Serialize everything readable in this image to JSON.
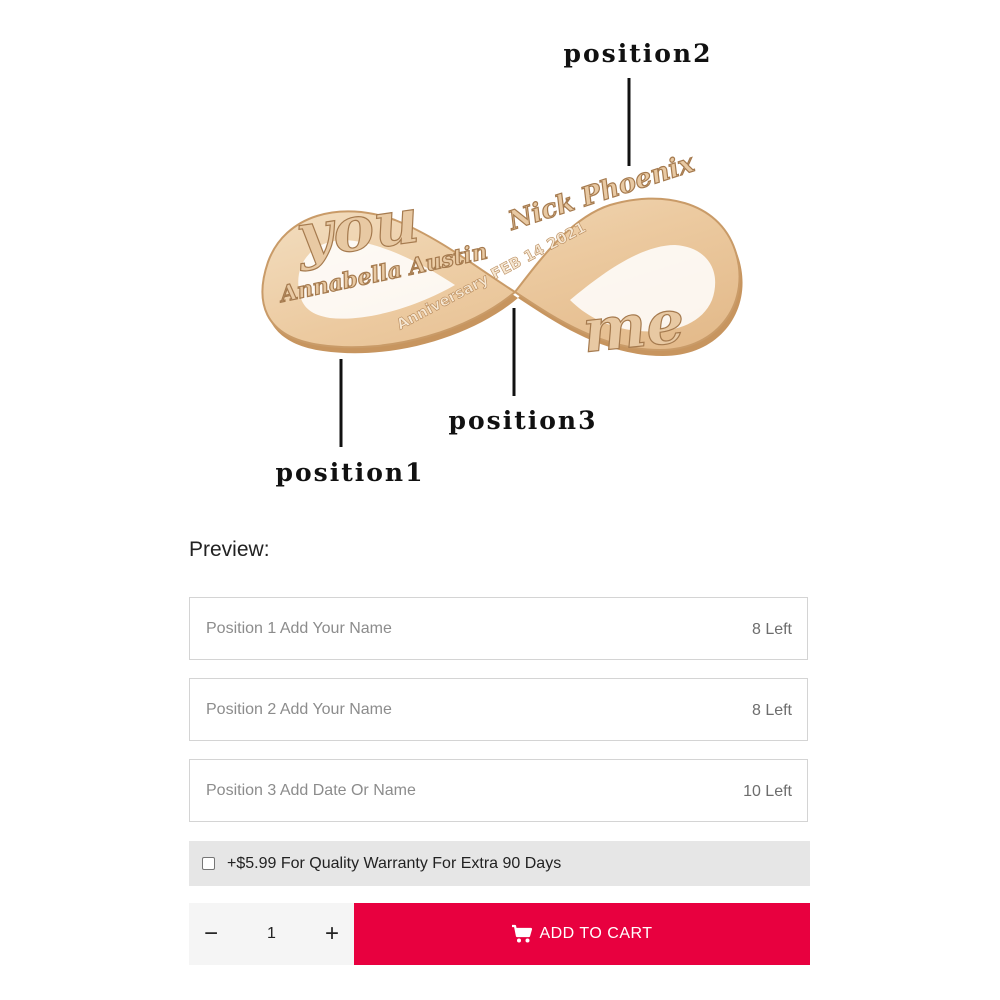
{
  "hero": {
    "callouts": {
      "position1": "position1",
      "position2": "position2",
      "position3": "position3"
    },
    "engraving": {
      "word_left": "you",
      "word_right": "me",
      "name_left": "Annabella Austin",
      "name_right": "Nick Phoenix",
      "date_text": "Anniversary FEB 14 2021"
    }
  },
  "preview_label": "Preview:",
  "fields": [
    {
      "placeholder": "Position 1 Add Your Name",
      "value": "",
      "counter": "8 Left"
    },
    {
      "placeholder": "Position 2 Add Your Name",
      "value": "",
      "counter": "8 Left"
    },
    {
      "placeholder": "Position 3 Add Date Or Name",
      "value": "",
      "counter": "10 Left"
    }
  ],
  "warranty": {
    "checked": false,
    "label": "+$5.99 For Quality Warranty For Extra 90 Days"
  },
  "quantity": {
    "minus": "−",
    "value": "1",
    "plus": "+"
  },
  "cart": {
    "label": "ADD TO CART",
    "icon": "cart-icon"
  },
  "colors": {
    "cart_button": "#e8003f",
    "warranty_bg": "#e6e6e6",
    "wood_light": "#f1d9b8",
    "wood_edge": "#c99b68"
  }
}
